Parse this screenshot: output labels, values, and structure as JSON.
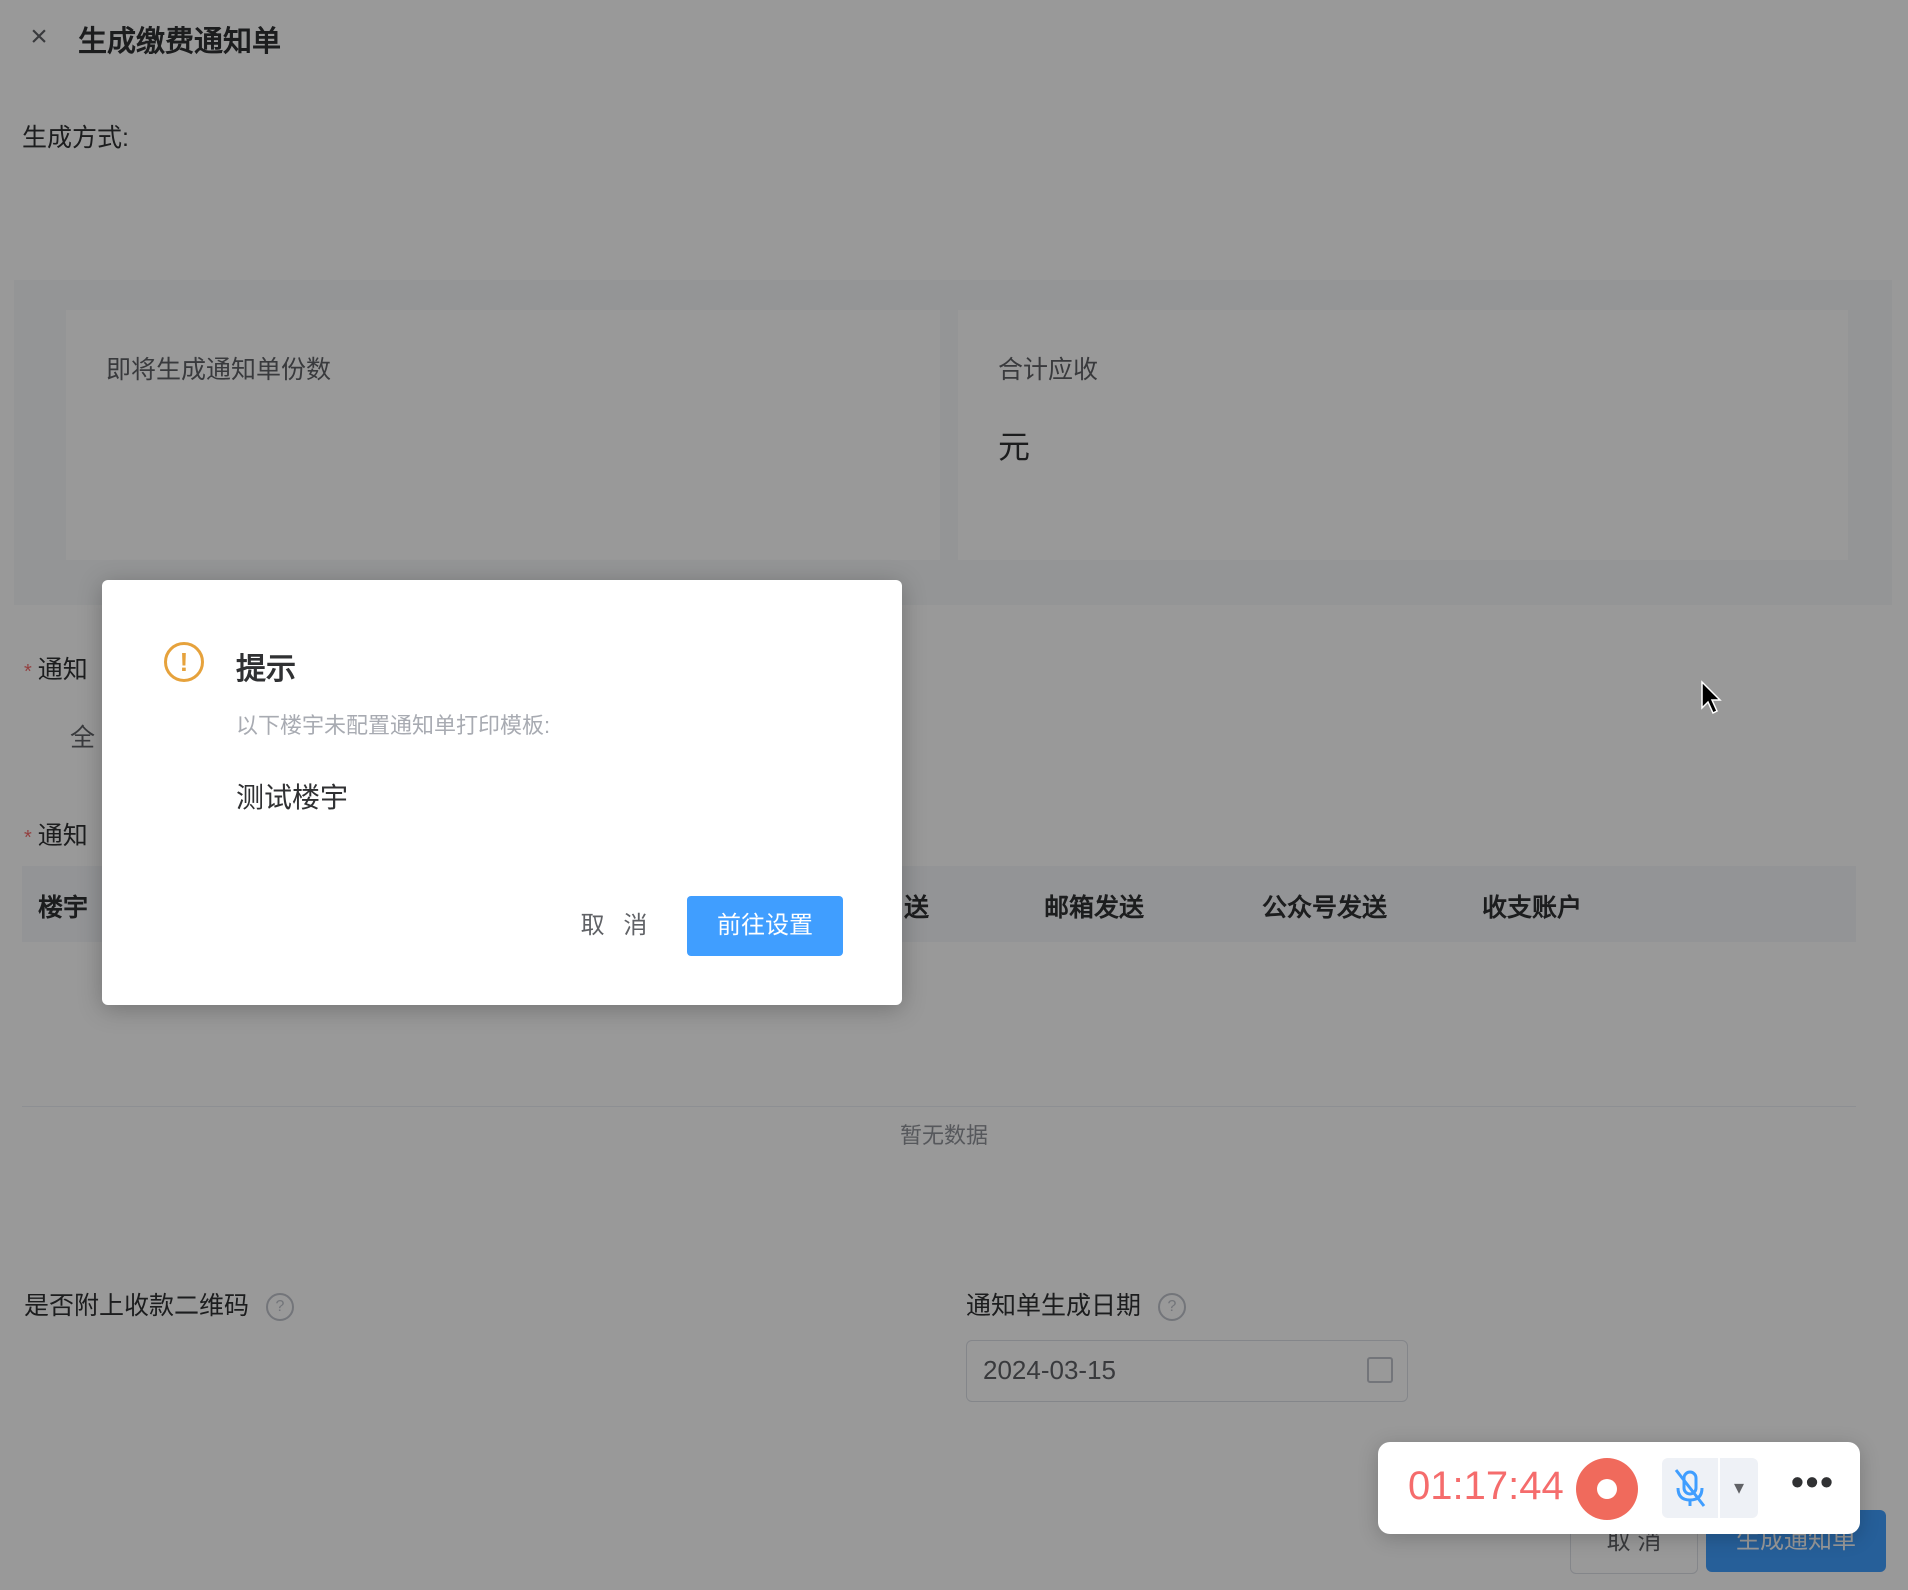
{
  "header": {
    "close_icon": "close-icon",
    "title": "生成缴费通知单"
  },
  "form": {
    "method_label": "生成方式:",
    "summary": {
      "count_label": "即将生成通知单份数",
      "total_label": "合计应收",
      "total_unit": "元"
    },
    "notice_label_1": "通知",
    "notice_radio_partial": "全",
    "notice_label_2": "通知",
    "table": {
      "columns": [
        "楼宇",
        "送",
        "邮箱发送",
        "公众号发送",
        "收支账户"
      ],
      "empty_text": "暂无数据"
    },
    "qr_label": "是否附上收款二维码",
    "date_label": "通知单生成日期",
    "date_value": "2024-03-15"
  },
  "footer": {
    "cancel": "取 消",
    "generate": "生成通知单"
  },
  "dialog": {
    "icon": "warning-icon",
    "title": "提示",
    "message": "以下楼宇未配置通知单打印模板:",
    "building": "测试楼宇",
    "cancel": "取 消",
    "go_settings": "前往设置"
  },
  "recorder": {
    "time": "01:17:44",
    "stop_icon": "record-stop-icon",
    "mic_icon": "mic-muted-icon",
    "more_icon": "more-icon"
  },
  "colors": {
    "primary": "#409eff",
    "warning": "#e6a23c",
    "record": "#f06a5c"
  }
}
